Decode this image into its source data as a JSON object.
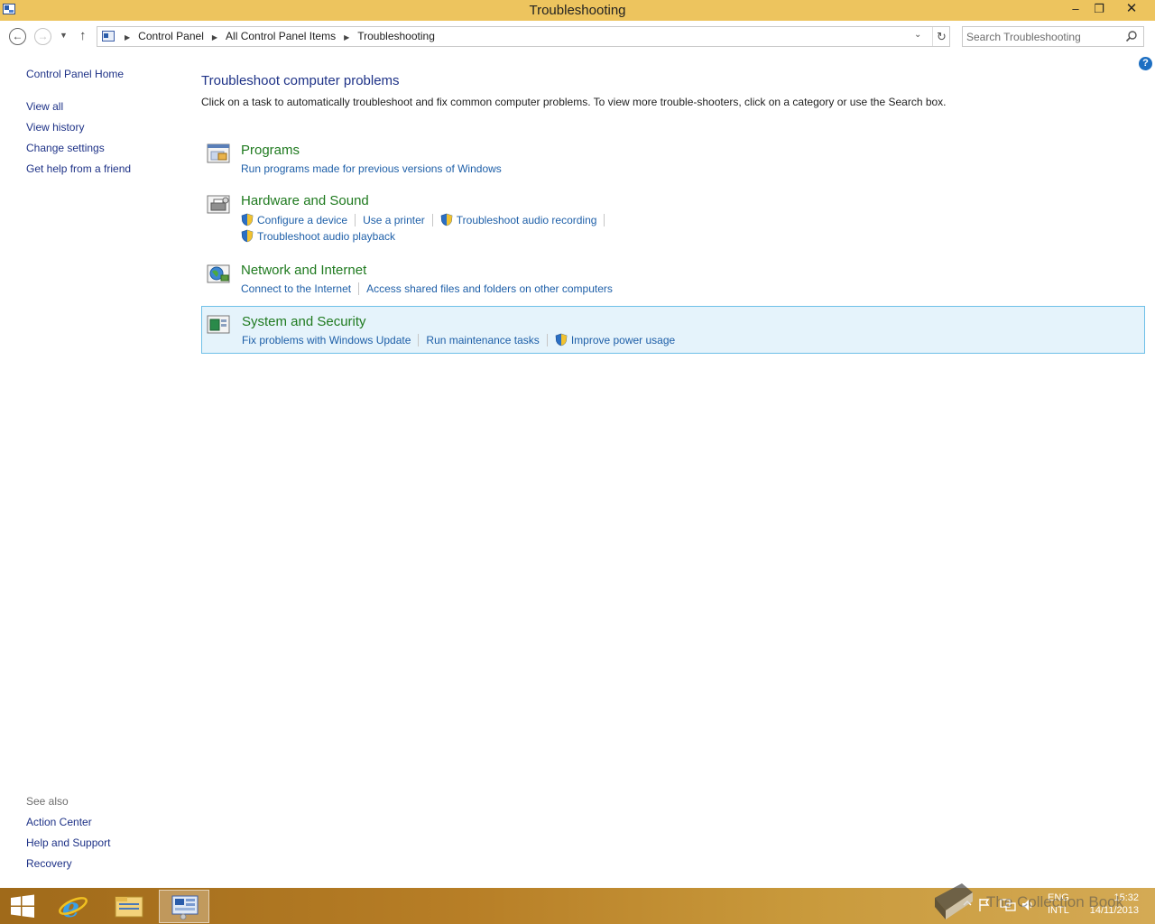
{
  "window": {
    "title": "Troubleshooting",
    "minimize_glyph": "–",
    "maximize_glyph": "❐",
    "close_glyph": "✕"
  },
  "address_bar": {
    "breadcrumbs": [
      "Control Panel",
      "All Control Panel Items",
      "Troubleshooting"
    ],
    "search_placeholder": "Search Troubleshooting"
  },
  "left_pane": {
    "home": "Control Panel Home",
    "links": [
      "View all",
      "View history",
      "Change settings",
      "Get help from a friend"
    ],
    "see_also_label": "See also",
    "see_also": [
      "Action Center",
      "Help and Support",
      "Recovery"
    ]
  },
  "main": {
    "title": "Troubleshoot computer problems",
    "description": "Click on a task to automatically troubleshoot and fix common computer problems. To view more trouble-shooters, click on a category or use the Search box.",
    "categories": [
      {
        "title": "Programs",
        "icon": "programs-icon",
        "links": [
          {
            "label": "Run programs made for previous versions of Windows",
            "shield": false
          }
        ]
      },
      {
        "title": "Hardware and Sound",
        "icon": "hardware-icon",
        "links": [
          {
            "label": "Configure a device",
            "shield": true
          },
          {
            "label": "Use a printer",
            "shield": false
          },
          {
            "label": "Troubleshoot audio recording",
            "shield": true
          },
          {
            "label": "Troubleshoot audio playback",
            "shield": true
          }
        ]
      },
      {
        "title": "Network and Internet",
        "icon": "network-icon",
        "links": [
          {
            "label": "Connect to the Internet",
            "shield": false
          },
          {
            "label": "Access shared files and folders on other computers",
            "shield": false
          }
        ]
      },
      {
        "title": "System and Security",
        "icon": "system-security-icon",
        "selected": true,
        "links": [
          {
            "label": "Fix problems with Windows Update",
            "shield": false
          },
          {
            "label": "Run maintenance tasks",
            "shield": false
          },
          {
            "label": "Improve power usage",
            "shield": true
          }
        ]
      }
    ]
  },
  "taskbar": {
    "pinned": [
      "start-icon",
      "internet-explorer-icon",
      "file-explorer-icon",
      "control-panel-icon"
    ],
    "language": "ENG",
    "keyboard": "INTL",
    "time": "15:32",
    "date": "14/11/2013",
    "watermark": "The Collection Book"
  },
  "colors": {
    "titlebar": "#edc45e",
    "link_blue": "#1e5fa8",
    "category_green": "#1f7a1f",
    "selection_bg": "#e5f3fb",
    "selection_border": "#6fc0e8"
  }
}
